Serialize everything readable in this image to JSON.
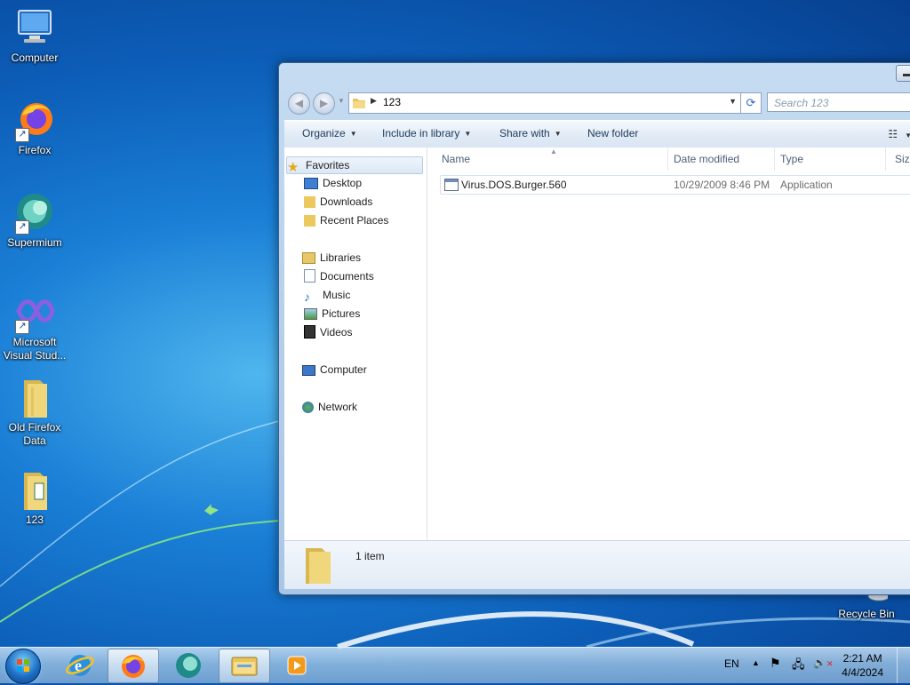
{
  "desktop": {
    "icons": [
      {
        "label": "Computer",
        "icon": "computer-icon"
      },
      {
        "label": "Firefox",
        "icon": "firefox-icon"
      },
      {
        "label": "Supermium",
        "icon": "supermium-icon"
      },
      {
        "label": "Microsoft Visual Stud...",
        "icon": "visual-studio-icon"
      },
      {
        "label": "Old Firefox Data",
        "icon": "folder-icon"
      },
      {
        "label": "123",
        "icon": "folder-icon"
      },
      {
        "label": "Recycle Bin",
        "icon": "recycle-bin-icon"
      }
    ]
  },
  "explorer": {
    "breadcrumb": "123",
    "search_placeholder": "Search 123",
    "toolbar": {
      "organize": "Organize",
      "include_in_library": "Include in library",
      "share_with": "Share with",
      "new_folder": "New folder"
    },
    "navpane": {
      "favorites": "Favorites",
      "desktop": "Desktop",
      "downloads": "Downloads",
      "recent_places": "Recent Places",
      "libraries": "Libraries",
      "documents": "Documents",
      "music": "Music",
      "pictures": "Pictures",
      "videos": "Videos",
      "computer": "Computer",
      "network": "Network"
    },
    "columns": {
      "name": "Name",
      "date_modified": "Date modified",
      "type": "Type",
      "size": "Size"
    },
    "files": [
      {
        "name": "Virus.DOS.Burger.560",
        "date_modified": "10/29/2009 8:46 PM",
        "type": "Application"
      }
    ],
    "status": "1 item"
  },
  "taskbar": {
    "language": "EN",
    "time": "2:21 AM",
    "date": "4/4/2024",
    "colors": {
      "accent": "#1d6fc4"
    }
  }
}
